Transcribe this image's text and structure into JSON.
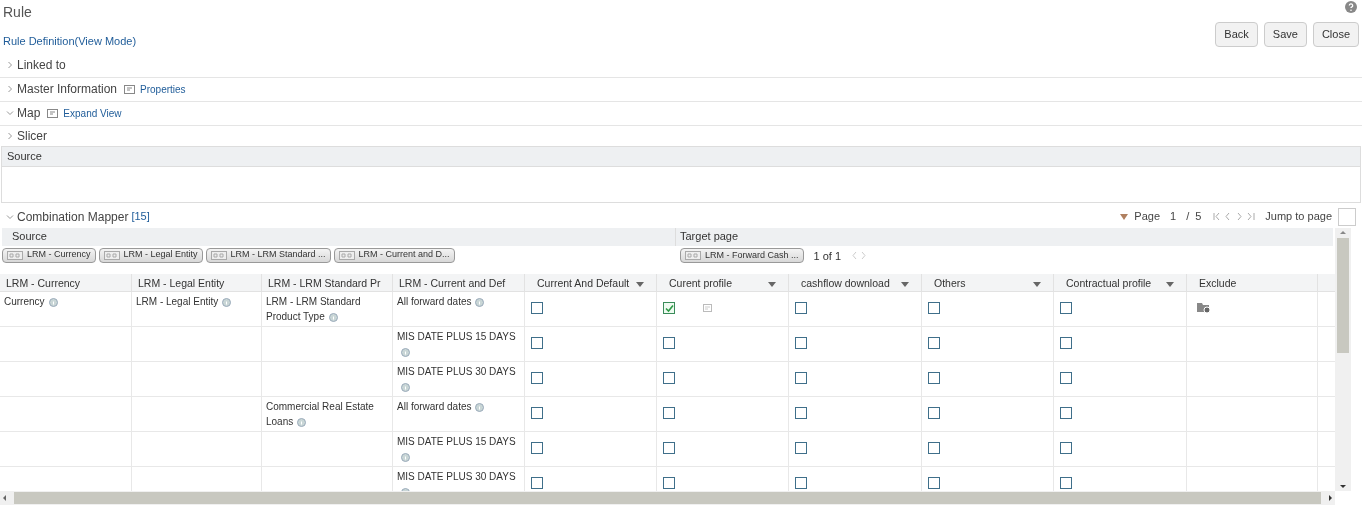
{
  "page": {
    "title": "Rule",
    "subtitle": "Rule Definition(View Mode)"
  },
  "buttons": [
    "Back",
    "Save",
    "Close"
  ],
  "sections": [
    {
      "label": "Linked to",
      "expanded": false
    },
    {
      "label": "Master Information",
      "expanded": false,
      "link": "Properties"
    },
    {
      "label": "Map",
      "expanded": true,
      "link": "Expand View"
    },
    {
      "label": "Slicer",
      "expanded": false
    }
  ],
  "source_panel": {
    "title": "Source"
  },
  "mapper": {
    "title": "Combination Mapper",
    "count": "[15]",
    "expanded": true,
    "pagination": {
      "label": "Page",
      "current": "1",
      "separator": "/",
      "total": "5",
      "jump_label": "Jump to page"
    },
    "source_label": "Source",
    "target_label": "Target page",
    "source_chips": [
      "LRM - Currency",
      "LRM - Legal Entity",
      "LRM - LRM Standard ...",
      "LRM - Current and D..."
    ],
    "target_chips": [
      "LRM - Forward Cash ..."
    ],
    "target_pager": "1 of 1",
    "columns": [
      {
        "label": "LRM - Currency",
        "dropdown": false
      },
      {
        "label": "LRM - Legal Entity",
        "dropdown": false
      },
      {
        "label": "LRM - LRM Standard Pr",
        "dropdown": false
      },
      {
        "label": "LRM - Current and Def",
        "dropdown": false
      },
      {
        "label": "Current And Default",
        "dropdown": true
      },
      {
        "label": "Curent profile",
        "dropdown": true
      },
      {
        "label": "cashflow download",
        "dropdown": true
      },
      {
        "label": "Others",
        "dropdown": true
      },
      {
        "label": "Contractual profile",
        "dropdown": true
      },
      {
        "label": "Exclude",
        "dropdown": false
      }
    ],
    "rows": [
      {
        "cells": [
          "Currency",
          "LRM - Legal Entity",
          "LRM - LRM Standard Product Type",
          "All forward dates"
        ],
        "checks": [
          false,
          true,
          false,
          false,
          false
        ],
        "exclude": true
      },
      {
        "cells": [
          null,
          null,
          null,
          "MIS DATE PLUS 15 DAYS"
        ],
        "checks": [
          false,
          false,
          false,
          false,
          false
        ],
        "exclude": false
      },
      {
        "cells": [
          null,
          null,
          null,
          "MIS DATE PLUS 30 DAYS"
        ],
        "checks": [
          false,
          false,
          false,
          false,
          false
        ],
        "exclude": false
      },
      {
        "cells": [
          null,
          null,
          "Commercial Real Estate Loans",
          "All forward dates"
        ],
        "checks": [
          false,
          false,
          false,
          false,
          false
        ],
        "exclude": false
      },
      {
        "cells": [
          null,
          null,
          null,
          "MIS DATE PLUS 15 DAYS"
        ],
        "checks": [
          false,
          false,
          false,
          false,
          false
        ],
        "exclude": false
      },
      {
        "cells": [
          null,
          null,
          null,
          "MIS DATE PLUS 30 DAYS"
        ],
        "checks": [
          false,
          false,
          false,
          false,
          false
        ],
        "exclude": false
      }
    ]
  }
}
